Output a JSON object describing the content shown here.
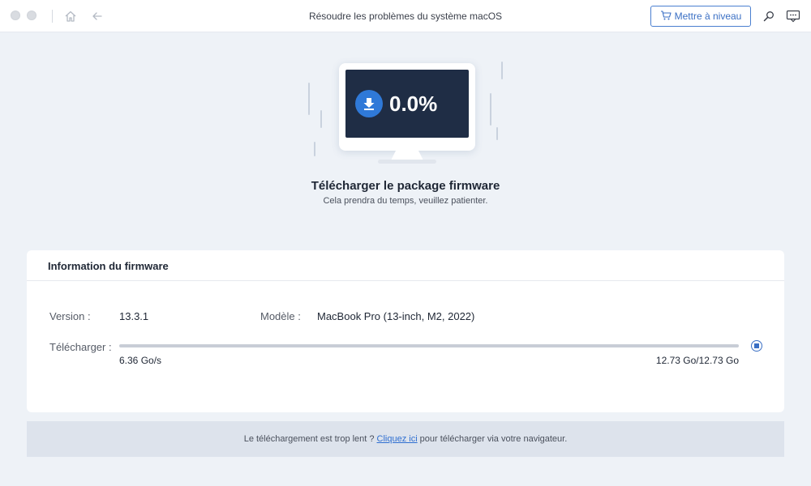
{
  "window": {
    "title": "Résoudre les problèmes du système macOS",
    "upgrade_label": "Mettre à niveau"
  },
  "icons": {
    "home": "home-icon",
    "back": "back-arrow-icon",
    "cart": "cart-icon",
    "search": "search-icon",
    "feedback": "feedback-icon",
    "download": "download-arrow-icon",
    "stop": "stop-icon"
  },
  "hero": {
    "percent": "0.0%",
    "progress": 0.0,
    "title": "Télécharger le package firmware",
    "subtitle": "Cela prendra du temps, veuillez patienter."
  },
  "firmware": {
    "title": "Information du firmware",
    "version_label": "Version :",
    "version_value": "13.3.1",
    "model_label": "Modèle :",
    "model_value": "MacBook Pro (13-inch, M2, 2022)",
    "download_label": "Télécharger :",
    "download_progress": 0.0,
    "speed": "6.36 Go/s",
    "size": "12.73 Go/12.73 Go"
  },
  "footer": {
    "text_before": "Le téléchargement est trop lent ?",
    "link": "Cliquez ici",
    "text_after": "pour télécharger via votre navigateur."
  },
  "colors": {
    "accent": "#3a6fc4",
    "screen": "#1f2d45",
    "background": "#eef2f7"
  }
}
